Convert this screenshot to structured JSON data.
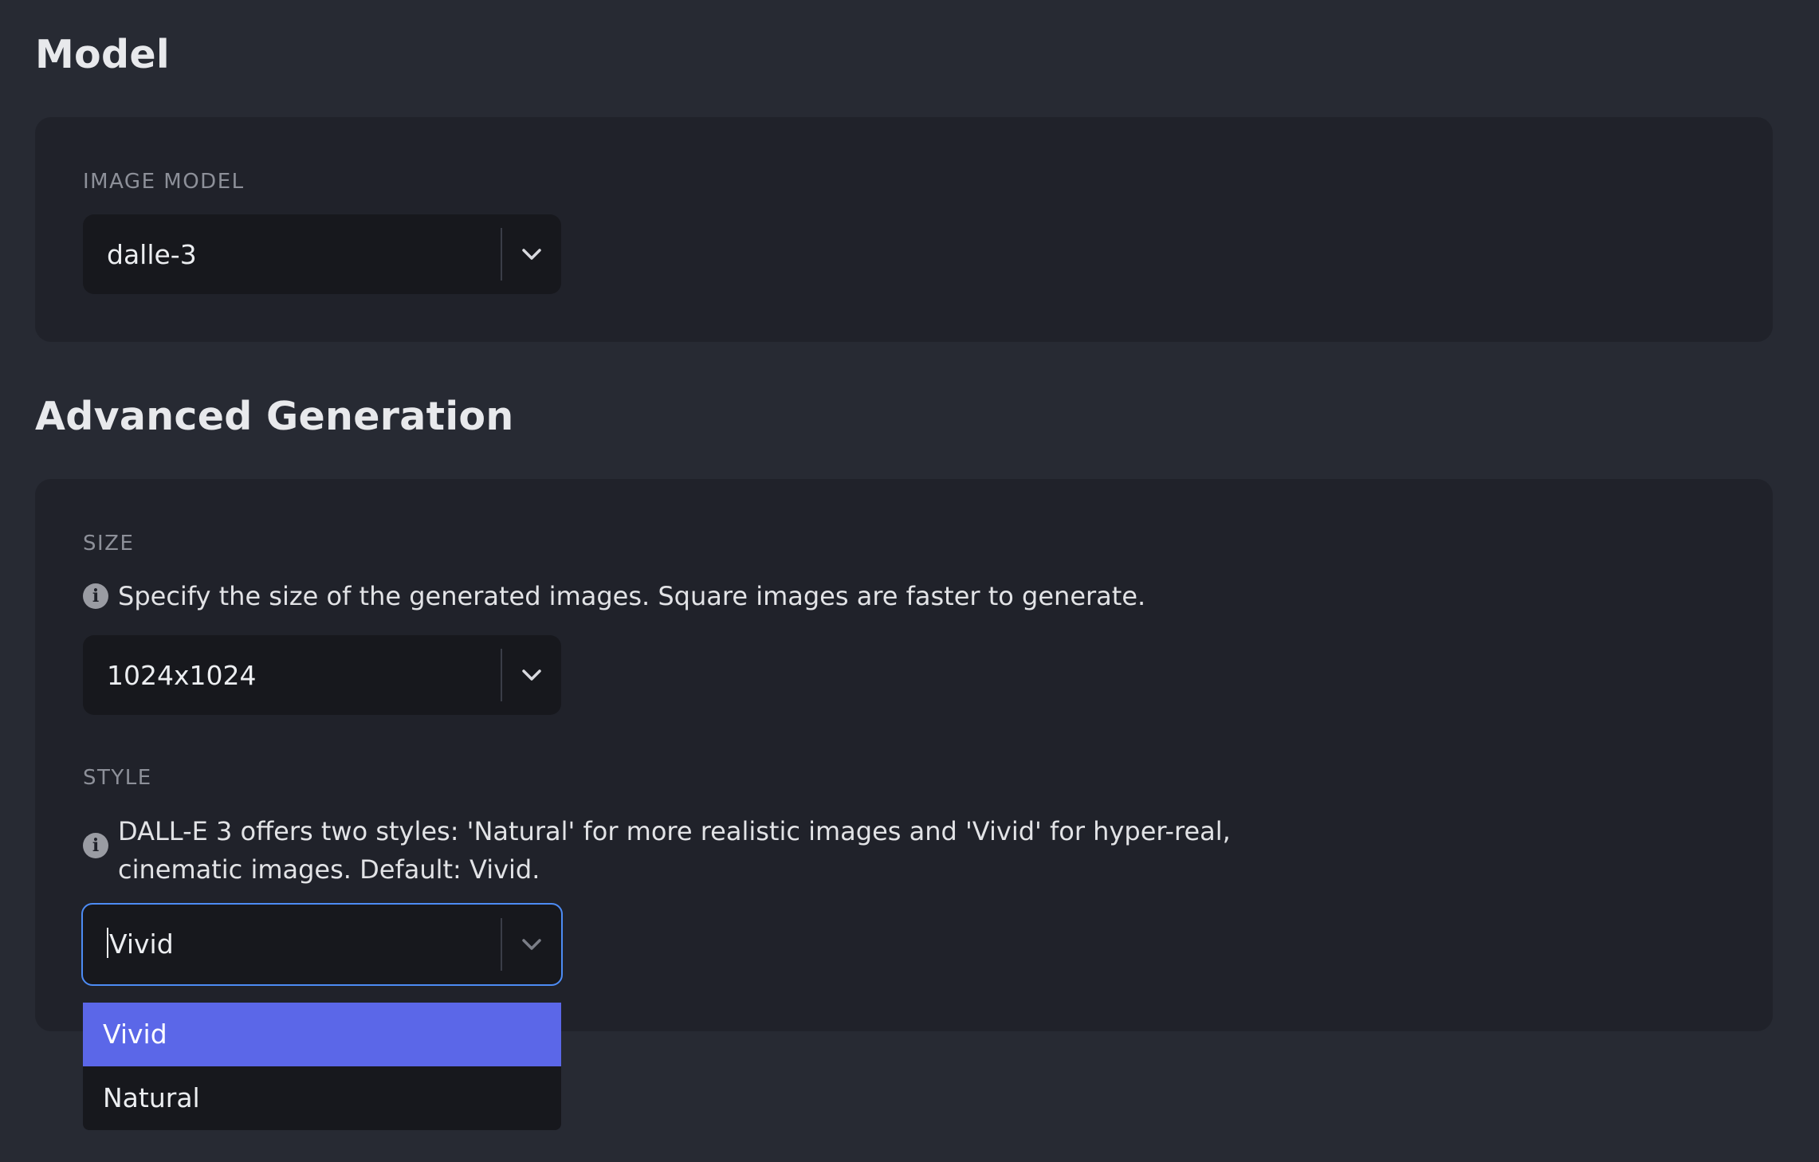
{
  "model_section": {
    "title": "Model",
    "image_model": {
      "label": "IMAGE MODEL",
      "value": "dalle-3"
    }
  },
  "advanced_section": {
    "title": "Advanced Generation",
    "size": {
      "label": "SIZE",
      "help": "Specify the size of the generated images. Square images are faster to generate.",
      "value": "1024x1024"
    },
    "style": {
      "label": "STYLE",
      "help_line1": "DALL-E 3 offers two styles: 'Natural' for more realistic images and 'Vivid' for hyper-real,",
      "help_line2": "cinematic images. Default: Vivid.",
      "value": "Vivid",
      "options": [
        "Vivid",
        "Natural"
      ],
      "selected_option": "Vivid"
    }
  },
  "icons": {
    "info": "info-icon",
    "chevron": "chevron-down-icon"
  },
  "colors": {
    "accent": "#5b67e8",
    "focus_border": "#4d8cf5",
    "background": "#272a33",
    "card": "#20222a",
    "input": "#17181d"
  }
}
